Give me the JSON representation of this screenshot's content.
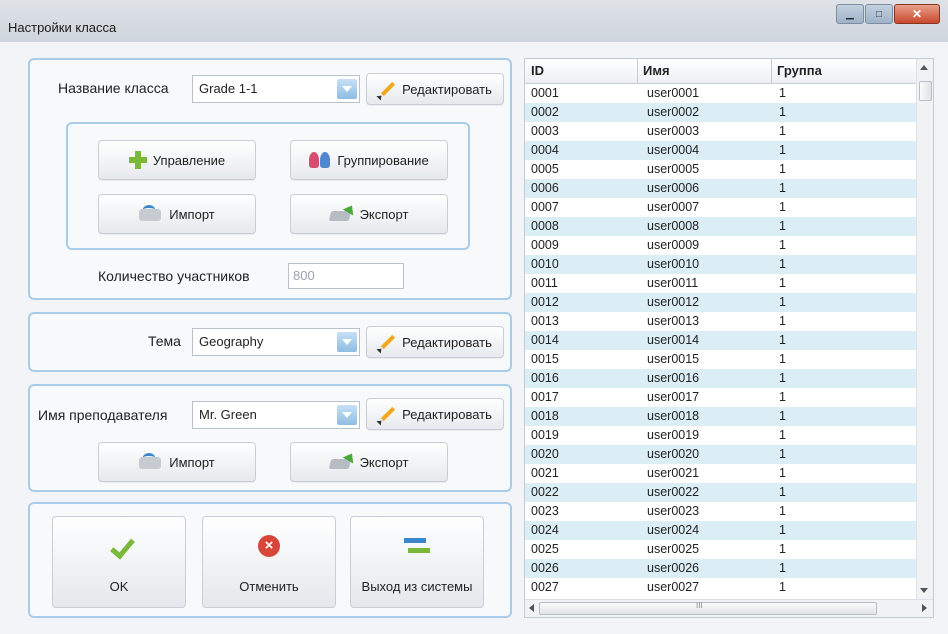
{
  "window": {
    "title": "Настройки класса"
  },
  "class_panel": {
    "label": "Название класса",
    "class_value": "Grade 1-1",
    "edit_label": "Редактировать",
    "manage_label": "Управление",
    "group_label": "Группирование",
    "import_label": "Импорт",
    "export_label": "Экспорт",
    "count_label": "Количество участников",
    "count_value": "800"
  },
  "theme_panel": {
    "label": "Тема",
    "value": "Geography",
    "edit_label": "Редактировать"
  },
  "teacher_panel": {
    "label": "Имя преподавателя",
    "value": "Mr. Green",
    "edit_label": "Редактировать",
    "import_label": "Импорт",
    "export_label": "Экспорт"
  },
  "actions": {
    "ok_label": "OK",
    "cancel_label": "Отменить",
    "logout_label": "Выход из системы"
  },
  "grid": {
    "columns": [
      "ID",
      "Имя",
      "Группа"
    ],
    "rows": [
      [
        "0001",
        "user0001",
        "1"
      ],
      [
        "0002",
        "user0002",
        "1"
      ],
      [
        "0003",
        "user0003",
        "1"
      ],
      [
        "0004",
        "user0004",
        "1"
      ],
      [
        "0005",
        "user0005",
        "1"
      ],
      [
        "0006",
        "user0006",
        "1"
      ],
      [
        "0007",
        "user0007",
        "1"
      ],
      [
        "0008",
        "user0008",
        "1"
      ],
      [
        "0009",
        "user0009",
        "1"
      ],
      [
        "0010",
        "user0010",
        "1"
      ],
      [
        "0011",
        "user0011",
        "1"
      ],
      [
        "0012",
        "user0012",
        "1"
      ],
      [
        "0013",
        "user0013",
        "1"
      ],
      [
        "0014",
        "user0014",
        "1"
      ],
      [
        "0015",
        "user0015",
        "1"
      ],
      [
        "0016",
        "user0016",
        "1"
      ],
      [
        "0017",
        "user0017",
        "1"
      ],
      [
        "0018",
        "user0018",
        "1"
      ],
      [
        "0019",
        "user0019",
        "1"
      ],
      [
        "0020",
        "user0020",
        "1"
      ],
      [
        "0021",
        "user0021",
        "1"
      ],
      [
        "0022",
        "user0022",
        "1"
      ],
      [
        "0023",
        "user0023",
        "1"
      ],
      [
        "0024",
        "user0024",
        "1"
      ],
      [
        "0025",
        "user0025",
        "1"
      ],
      [
        "0026",
        "user0026",
        "1"
      ],
      [
        "0027",
        "user0027",
        "1"
      ]
    ]
  }
}
